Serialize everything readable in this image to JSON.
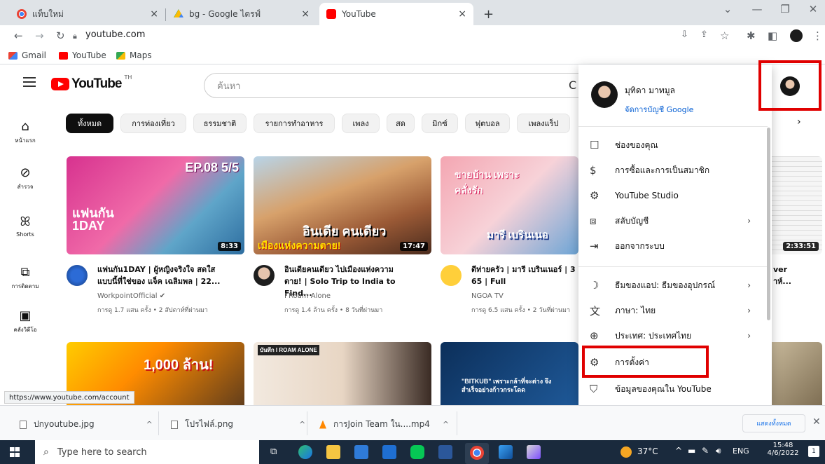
{
  "browser": {
    "tabs": [
      {
        "title": "แท็บใหม่",
        "active": false
      },
      {
        "title": "bg - Google ไดรฟ์",
        "active": false
      },
      {
        "title": "YouTube",
        "active": true
      }
    ],
    "new_tab": "+",
    "url": "youtube.com",
    "bookmarks": [
      "Gmail",
      "YouTube",
      "Maps"
    ],
    "status_url": "https://www.youtube.com/account"
  },
  "youtube": {
    "logo_text": "YouTube",
    "region": "TH",
    "search_placeholder": "ค้นหา",
    "rail": [
      "หน้าแรก",
      "สำรวจ",
      "Shorts",
      "การติดตาม",
      "คลังวิดีโอ"
    ],
    "chips": [
      "ทั้งหมด",
      "การท่องเที่ยว",
      "ธรรมชาติ",
      "รายการทำอาหาร",
      "เพลง",
      "สด",
      "มิกซ์",
      "ฟุตบอล",
      "เพลงแร็ป"
    ],
    "videos": [
      {
        "title1": "แฟนกัน1DAY | ผู้หญิงจริงใจ สดใส",
        "title2": "แบบนี้ที่ใช่ของ แจ็ค เฉลิมพล | 22...",
        "channel": "WorkpointOfficial ✔",
        "meta": "การดู 1.7 แสน ครั้ง • 2 สัปดาห์ที่ผ่านมา",
        "duration": "8:33",
        "overlay": "EP.08 5/5",
        "overlay2": "แฟนกัน 1DAY"
      },
      {
        "title1": "อินเดียคนเดียว ไปเมืองแห่งความ",
        "title2": "ตาย! | Solo Trip to India to Find...",
        "channel": "I Roam Alone",
        "meta": "การดู 1.4 ล้าน ครั้ง • 8 วันที่ผ่านมา",
        "duration": "17:47",
        "overlay": "อินเดีย คนเดียว",
        "overlay2": "เมืองแห่งความตาย!"
      },
      {
        "title1": "ดีท่ายครัว | มารี เบรินเนอร์ | 3",
        "title2": "65 | Full",
        "channel": "NGOA TV",
        "meta": "การดู 6.5 แสน ครั้ง • 2 วันที่ผ่านมา",
        "duration": "",
        "overlay": "ขายบ้าน เพราะคลั่งรัก",
        "overlay2": "มารี เบรินเนอ"
      },
      {
        "duration": "2:33:51",
        "title_fragment": "ver",
        "title_fragment2": "าห์..."
      }
    ],
    "row2": [
      {
        "overlay": "1,000 ล้าน!"
      },
      {
        "overlay": "บันทึก I ROAM ALONE"
      },
      {
        "overlay": "\"BITKUB\" เพราะกล้าที่จะต่าง จึงสำเร็จอย่างก้าวกระโดด"
      }
    ]
  },
  "account_menu": {
    "user_name": "มุทิดา มาทมูล",
    "manage_account": "จัดการบัญชี Google",
    "items": [
      {
        "label": "ช่องของคุณ",
        "icon": "channel-icon",
        "chevron": false
      },
      {
        "label": "การซื้อและการเป็นสมาชิก",
        "icon": "dollar-icon",
        "chevron": false
      },
      {
        "label": "YouTube Studio",
        "icon": "studio-gear-icon",
        "chevron": false
      },
      {
        "label": "สลับบัญชี",
        "icon": "switch-account-icon",
        "chevron": true
      },
      {
        "label": "ออกจากระบบ",
        "icon": "sign-out-icon",
        "chevron": false
      },
      {
        "label": "ธีมของแอป: ธีมของอุปกรณ์",
        "icon": "moon-icon",
        "chevron": true
      },
      {
        "label": "ภาษา: ไทย",
        "icon": "translate-icon",
        "chevron": true
      },
      {
        "label": "ประเทศ: ประเทศไทย",
        "icon": "globe-icon",
        "chevron": true
      },
      {
        "label": "การตั้งค่า",
        "icon": "settings-gear-icon",
        "chevron": false
      },
      {
        "label": "ข้อมูลของคุณใน YouTube",
        "icon": "data-shield-icon",
        "chevron": false
      }
    ]
  },
  "downloads": {
    "items": [
      "ปกyoutube.jpg",
      "โปรไฟล์.png",
      "การJoin Team ใน....mp4"
    ],
    "show_all": "แสดงทั้งหมด"
  },
  "taskbar": {
    "search_placeholder": "Type here to search",
    "temperature": "37°C",
    "language": "ENG",
    "time": "15:48",
    "date": "4/6/2022",
    "notification_count": "1"
  },
  "colors": {
    "youtube_red": "#ff0000",
    "highlight_red": "#e00000",
    "link_blue": "#065fd4",
    "taskbar": "#1a2a3d"
  }
}
